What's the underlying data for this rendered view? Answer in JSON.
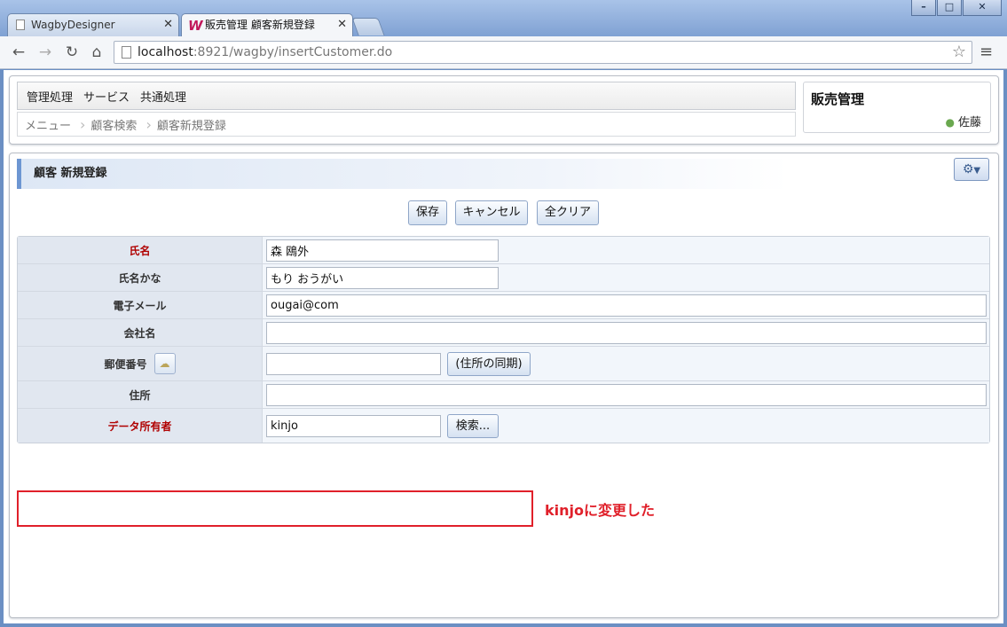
{
  "browser": {
    "tabs": [
      {
        "title": "WagbyDesigner",
        "active": false
      },
      {
        "title": "販売管理 顧客新規登録",
        "active": true
      }
    ],
    "window_buttons": {
      "minimize": "–",
      "maximize": "□",
      "close": "✕"
    },
    "url_host": "localhost",
    "url_rest": ":8921/wagby/insertCustomer.do"
  },
  "menubar": {
    "items": [
      "管理処理",
      "サービス",
      "共通処理"
    ]
  },
  "breadcrumb": {
    "items": [
      "メニュー",
      "顧客検索",
      "顧客新規登録"
    ]
  },
  "app": {
    "title": "販売管理",
    "user": "佐藤"
  },
  "section": {
    "title": "顧客 新規登録"
  },
  "actions": {
    "save": "保存",
    "cancel": "キャンセル",
    "clear_all": "全クリア"
  },
  "form": {
    "name": {
      "label": "氏名",
      "value": "森 鴎外"
    },
    "name_kana": {
      "label": "氏名かな",
      "value": "もり おうがい"
    },
    "email": {
      "label": "電子メール",
      "value": "ougai@com"
    },
    "company": {
      "label": "会社名",
      "value": ""
    },
    "postal_code": {
      "label": "郵便番号",
      "value": "",
      "sync_label": "(住所の同期)"
    },
    "address": {
      "label": "住所",
      "value": ""
    },
    "data_owner": {
      "label": "データ所有者",
      "value": "kinjo",
      "search_label": "検索..."
    }
  },
  "annotation": {
    "text": "kinjoに変更した",
    "color": "#e0202a"
  },
  "colors": {
    "required_label": "#b00000",
    "accent": "#6d96d2"
  }
}
